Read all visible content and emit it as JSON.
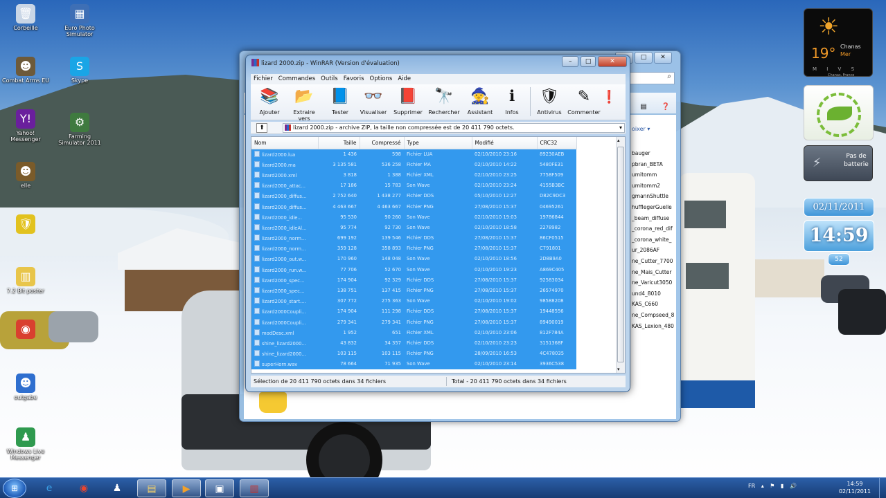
{
  "desktop": {
    "icons": [
      {
        "label": "Corbeille",
        "glyph": "🗑",
        "color": "#c9d6e6",
        "icon": "recycle-bin-icon"
      },
      {
        "label": "Euro Photo Simulator",
        "glyph": "▦",
        "color": "#3e6fb5",
        "icon": "game-icon"
      },
      {
        "label": "Combat Arms EU",
        "glyph": "☻",
        "color": "#6d5a3a",
        "icon": "soldier-icon"
      },
      {
        "label": "Skype",
        "glyph": "S",
        "color": "#1aa5e6",
        "icon": "skype-icon"
      },
      {
        "label": "Yahoo! Messenger",
        "glyph": "Y!",
        "color": "#6a1f9d",
        "icon": "yahoo-icon"
      },
      {
        "label": "Farming Simulator 2011",
        "glyph": "⚙",
        "color": "#3f7a3f",
        "icon": "tractor-icon"
      },
      {
        "label": "elle",
        "glyph": "☻",
        "color": "#7a5b2a",
        "icon": "user-icon"
      },
      {
        "label": "",
        "glyph": "🛡",
        "color": "#e2c21e",
        "icon": "shield-icon"
      },
      {
        "label": "7.2 Bit poster",
        "glyph": "▥",
        "color": "#e8c54a",
        "icon": "document-icon"
      },
      {
        "label": "",
        "glyph": "◉",
        "color": "#d9402f",
        "icon": "chrome-icon"
      },
      {
        "label": "outgabe",
        "glyph": "☻",
        "color": "#2f6fcf",
        "icon": "app-icon"
      },
      {
        "label": "Windows Live Messenger",
        "glyph": "♟",
        "color": "#2f9a4f",
        "icon": "messenger-icon"
      }
    ]
  },
  "gadgets": {
    "weather": {
      "temp": "19°",
      "city": "Chanas",
      "day": "Mer",
      "days": "M I V S",
      "location": "Chanas, France"
    },
    "battery": {
      "text": "Pas de batterie"
    },
    "date": "02/11/2011",
    "clock": "14:59",
    "week": "52"
  },
  "explorer": {
    "controls": {
      "min": "–",
      "max": "□",
      "close": "✕"
    },
    "sort_label": "oixer ▾",
    "files": [
      "bauger",
      "pbran_BETA",
      "umitomm",
      "umitomm2",
      "gmannShuttle",
      "hufflegerGuelle",
      "_beam_diffuse",
      "_corona_red_dif",
      "_corona_white_",
      "ur_2086AF",
      "ne_Cutter_7700",
      "ne_Mais_Cutter",
      "ne_Varicut3050",
      "und4_8010",
      "KAS_C660",
      "ne_Compseed_8",
      "KAS_Lexion_480"
    ]
  },
  "winrar": {
    "title": "lizard 2000.zip - WinRAR (Version d'évaluation)",
    "menu": [
      "Fichier",
      "Commandes",
      "Outils",
      "Favoris",
      "Options",
      "Aide"
    ],
    "tools": [
      {
        "label": "Ajouter",
        "glyph": "📚",
        "icon": "add-icon"
      },
      {
        "label": "Extraire vers",
        "glyph": "📂",
        "icon": "extract-icon"
      },
      {
        "label": "Tester",
        "glyph": "📘",
        "icon": "test-icon"
      },
      {
        "label": "Visualiser",
        "glyph": "👓",
        "icon": "view-icon"
      },
      {
        "label": "Supprimer",
        "glyph": "📕",
        "icon": "delete-icon"
      },
      {
        "label": "Rechercher",
        "glyph": "🔭",
        "icon": "find-icon"
      },
      {
        "label": "Assistant",
        "glyph": "🧙",
        "icon": "wizard-icon"
      },
      {
        "label": "Infos",
        "glyph": "ℹ",
        "icon": "info-icon"
      },
      {
        "label": "Antivirus",
        "glyph": "🛡",
        "icon": "antivirus-icon"
      },
      {
        "label": "Commenter",
        "glyph": "✎",
        "icon": "comment-icon"
      }
    ],
    "path": "lizard 2000.zip - archive ZIP, la taille non compressée est de 20 411 790 octets.",
    "columns": [
      "Nom",
      "Taille",
      "Compressé",
      "Type",
      "Modifié",
      "CRC32"
    ],
    "rows": [
      [
        "lizard2000.lua",
        "1 436",
        "598",
        "Fichier LUA",
        "02/10/2010 23:16",
        "89230AEB"
      ],
      [
        "lizard2000.ma",
        "3 135 581",
        "536 258",
        "Fichier MA",
        "02/10/2010 14:22",
        "5480FE31"
      ],
      [
        "lizard2000.xml",
        "3 818",
        "1 388",
        "Fichier XML",
        "02/10/2010 23:25",
        "7758F509"
      ],
      [
        "lizard2000_attac...",
        "17 186",
        "15 783",
        "Son Wave",
        "02/10/2010 23:24",
        "4155B3BC"
      ],
      [
        "lizard2000_diffus...",
        "2 752 640",
        "1 438 277",
        "Fichier DDS",
        "05/10/2010 12:27",
        "D82C9DC3"
      ],
      [
        "lizard2000_diffus...",
        "4 463 667",
        "4 463 667",
        "Fichier PNG",
        "27/08/2010 15:37",
        "04695261"
      ],
      [
        "lizard2000_idle...",
        "95 530",
        "90 260",
        "Son Wave",
        "02/10/2010 19:03",
        "19786844"
      ],
      [
        "lizard2000_idleAl...",
        "95 774",
        "92 730",
        "Son Wave",
        "02/10/2010 18:58",
        "2278982"
      ],
      [
        "lizard2000_norm...",
        "699 192",
        "139 546",
        "Fichier DDS",
        "27/08/2010 15:37",
        "86CF0515"
      ],
      [
        "lizard2000_norm...",
        "359 128",
        "358 893",
        "Fichier PNG",
        "27/08/2010 15:37",
        "C791801"
      ],
      [
        "lizard2000_out.w...",
        "170 960",
        "148 048",
        "Son Wave",
        "02/10/2010 18:56",
        "2D8B9A0"
      ],
      [
        "lizard2000_run.w...",
        "77 706",
        "52 670",
        "Son Wave",
        "02/10/2010 19:23",
        "A869C405"
      ],
      [
        "lizard2000_spec...",
        "174 904",
        "92 329",
        "Fichier DDS",
        "27/08/2010 15:37",
        "92583034"
      ],
      [
        "lizard2000_spec...",
        "138 751",
        "137 415",
        "Fichier PNG",
        "27/08/2010 15:37",
        "26574970"
      ],
      [
        "lizard2000_start....",
        "307 772",
        "275 363",
        "Son Wave",
        "02/10/2010 19:02",
        "98588208"
      ],
      [
        "lizard2000Coupli...",
        "174 904",
        "111 298",
        "Fichier DDS",
        "27/08/2010 15:37",
        "19448556"
      ],
      [
        "lizard2000Coupli...",
        "279 341",
        "279 341",
        "Fichier PNG",
        "27/08/2010 15:37",
        "89490019"
      ],
      [
        "modDesc.xml",
        "1 952",
        "651",
        "Fichier XML",
        "02/10/2010 23:06",
        "812F784A"
      ],
      [
        "shine_lizard2000...",
        "43 832",
        "34 357",
        "Fichier DDS",
        "02/10/2010 23:23",
        "3151368F"
      ],
      [
        "shine_lizard2000...",
        "103 115",
        "103 115",
        "Fichier PNG",
        "28/09/2010 16:53",
        "4C478035"
      ],
      [
        "superHorn.wav",
        "78 664",
        "71 935",
        "Son Wave",
        "02/10/2010 23:14",
        "3936C538"
      ]
    ],
    "status_left": "Sélection de 20 411 790 octets dans 34 fichiers",
    "status_right": "Total - 20 411 790 octets dans 34 fichiers",
    "colors": {
      "selection": "#3399ee"
    }
  },
  "taskbar": {
    "apps": [
      {
        "glyph": "e",
        "icon": "ie-icon",
        "color": "#3aa0e8"
      },
      {
        "glyph": "◉",
        "icon": "chrome-taskbar-icon",
        "color": "#e8452f"
      },
      {
        "glyph": "♟",
        "icon": "messenger-taskbar-icon",
        "color": "#ffffff"
      },
      {
        "glyph": "▤",
        "icon": "explorer-taskbar-icon",
        "color": "#f4d16a"
      },
      {
        "glyph": "▶",
        "icon": "media-player-icon",
        "color": "#f2a12b"
      },
      {
        "glyph": "▣",
        "icon": "remote-icon",
        "color": "#ffffff"
      },
      {
        "glyph": "▥",
        "icon": "winrar-taskbar-icon",
        "color": "#c6302a"
      }
    ],
    "tray": {
      "lang": "FR"
    },
    "clock": {
      "time": "14:59",
      "date": "02/11/2011"
    }
  }
}
